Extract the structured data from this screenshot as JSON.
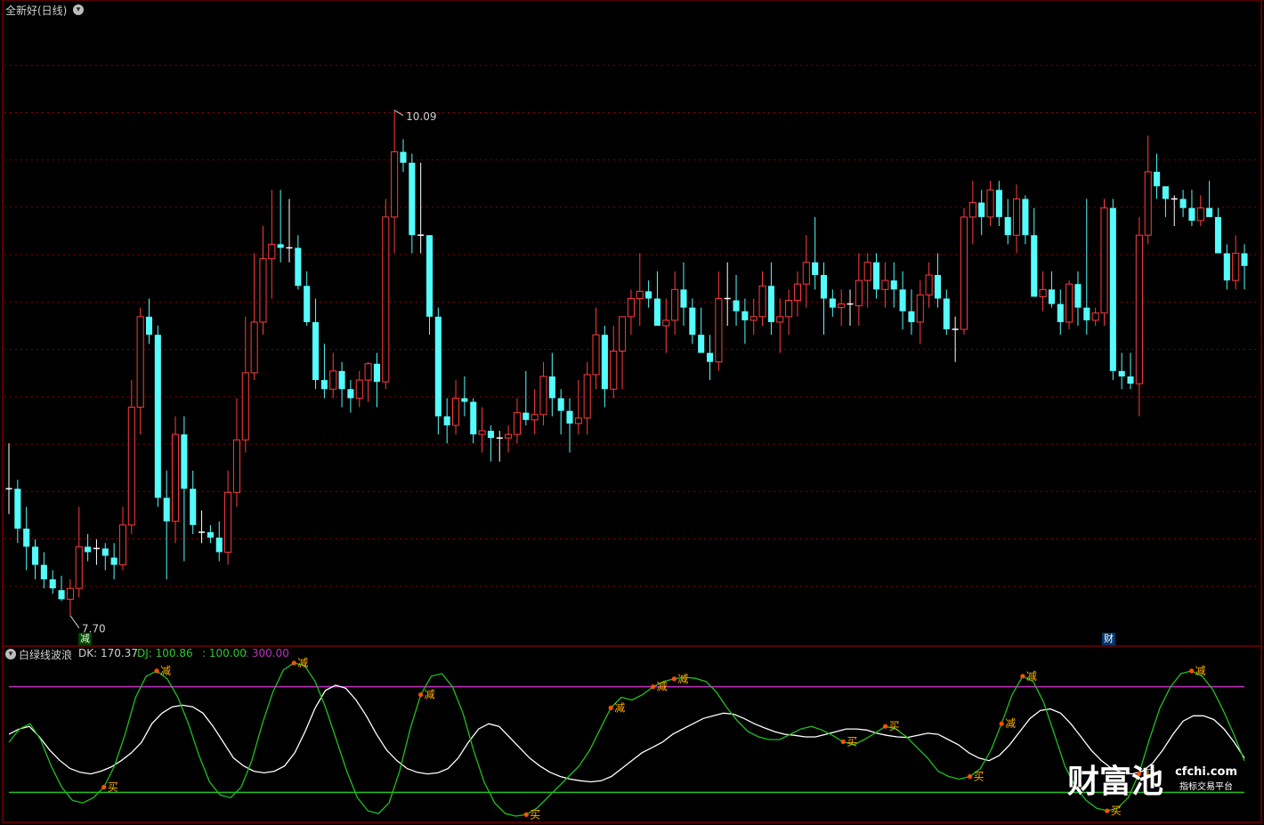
{
  "main_panel": {
    "title": "全新好(日线)",
    "high_label": "10.09",
    "low_label": "7.70",
    "badge_left": "减",
    "badge_right": "财",
    "colors": {
      "up": "#ff3c3c",
      "down": "#54fcfc",
      "grid": "#8b0000",
      "frame": "#aa0000"
    }
  },
  "indicator_panel": {
    "name": "白绿线波浪",
    "dk_label": "DK: 170.37",
    "dj_label": "DJ: 100.86",
    "line1_label": ": 100.00",
    "line2_label": ": 300.00",
    "colors": {
      "dk": "#ffffff",
      "dj": "#20c020",
      "line100": "#20c020",
      "line300": "#c030c0",
      "signal_text": "#ffb000",
      "signal_dot": "#ff5000"
    }
  },
  "watermark": {
    "brand": "财富池",
    "site": "cfchi.com",
    "tagline": "指标交易平台"
  },
  "chart_data": [
    {
      "type": "candlestick",
      "title": "全新好(日线)",
      "ylim": [
        7.2,
        10.6
      ],
      "annotations": [
        {
          "text": "10.09",
          "value": 10.09,
          "kind": "high"
        },
        {
          "text": "7.70",
          "value": 7.7,
          "kind": "low"
        }
      ],
      "ohlc": [
        [
          8.0,
          8.25,
          7.86,
          7.99
        ],
        [
          8.0,
          8.05,
          7.7,
          7.78
        ],
        [
          7.78,
          7.9,
          7.55,
          7.68
        ],
        [
          7.68,
          7.72,
          7.5,
          7.58
        ],
        [
          7.58,
          7.65,
          7.45,
          7.5
        ],
        [
          7.5,
          7.55,
          7.42,
          7.45
        ],
        [
          7.44,
          7.52,
          7.38,
          7.39
        ],
        [
          7.39,
          7.5,
          7.3,
          7.45
        ],
        [
          7.45,
          7.9,
          7.4,
          7.68
        ],
        [
          7.68,
          7.75,
          7.6,
          7.65
        ],
        [
          7.66,
          7.72,
          7.58,
          7.67
        ],
        [
          7.67,
          7.7,
          7.55,
          7.63
        ],
        [
          7.62,
          7.7,
          7.5,
          7.58
        ],
        [
          7.58,
          7.9,
          7.55,
          7.8
        ],
        [
          7.8,
          8.6,
          7.75,
          8.45
        ],
        [
          8.45,
          9.0,
          8.3,
          8.95
        ],
        [
          8.95,
          9.05,
          8.8,
          8.85
        ],
        [
          8.85,
          8.9,
          7.9,
          7.95
        ],
        [
          7.95,
          8.1,
          7.5,
          7.82
        ],
        [
          7.82,
          8.4,
          7.7,
          8.3
        ],
        [
          8.3,
          8.4,
          7.6,
          8.0
        ],
        [
          8.0,
          8.1,
          7.75,
          7.8
        ],
        [
          7.75,
          7.88,
          7.7,
          7.76
        ],
        [
          7.76,
          7.8,
          7.7,
          7.73
        ],
        [
          7.73,
          7.82,
          7.6,
          7.65
        ],
        [
          7.65,
          8.1,
          7.58,
          7.98
        ],
        [
          7.98,
          8.5,
          7.9,
          8.27
        ],
        [
          8.27,
          8.95,
          8.2,
          8.64
        ],
        [
          8.64,
          9.3,
          8.6,
          8.92
        ],
        [
          8.92,
          9.45,
          8.85,
          9.27
        ],
        [
          9.27,
          9.65,
          9.05,
          9.35
        ],
        [
          9.35,
          9.65,
          9.25,
          9.33
        ],
        [
          9.33,
          9.6,
          9.25,
          9.33
        ],
        [
          9.33,
          9.4,
          9.1,
          9.12
        ],
        [
          9.12,
          9.2,
          8.9,
          8.92
        ],
        [
          8.92,
          9.05,
          8.55,
          8.6
        ],
        [
          8.6,
          8.8,
          8.5,
          8.55
        ],
        [
          8.55,
          8.75,
          8.5,
          8.65
        ],
        [
          8.65,
          8.7,
          8.45,
          8.55
        ],
        [
          8.55,
          8.6,
          8.42,
          8.5
        ],
        [
          8.5,
          8.65,
          8.45,
          8.6
        ],
        [
          8.6,
          8.7,
          8.48,
          8.69
        ],
        [
          8.69,
          8.75,
          8.45,
          8.59
        ],
        [
          8.59,
          9.6,
          8.55,
          9.5
        ],
        [
          9.5,
          10.09,
          9.3,
          9.86
        ],
        [
          9.86,
          9.93,
          9.75,
          9.8
        ],
        [
          9.8,
          9.85,
          9.3,
          9.4
        ],
        [
          9.4,
          9.8,
          9.3,
          9.4
        ],
        [
          9.4,
          9.4,
          8.85,
          8.95
        ],
        [
          8.95,
          9.0,
          8.3,
          8.4
        ],
        [
          8.4,
          8.5,
          8.25,
          8.35
        ],
        [
          8.35,
          8.6,
          8.3,
          8.5
        ],
        [
          8.5,
          8.62,
          8.4,
          8.48
        ],
        [
          8.48,
          8.5,
          8.25,
          8.3
        ],
        [
          8.3,
          8.45,
          8.2,
          8.32
        ],
        [
          8.32,
          8.35,
          8.15,
          8.28
        ],
        [
          8.28,
          8.32,
          8.15,
          8.28
        ],
        [
          8.28,
          8.35,
          8.2,
          8.3
        ],
        [
          8.3,
          8.5,
          8.25,
          8.42
        ],
        [
          8.42,
          8.65,
          8.35,
          8.38
        ],
        [
          8.38,
          8.55,
          8.3,
          8.41
        ],
        [
          8.41,
          8.7,
          8.35,
          8.62
        ],
        [
          8.62,
          8.75,
          8.4,
          8.5
        ],
        [
          8.5,
          8.55,
          8.3,
          8.43
        ],
        [
          8.43,
          8.5,
          8.2,
          8.36
        ],
        [
          8.36,
          8.6,
          8.3,
          8.39
        ],
        [
          8.39,
          8.7,
          8.3,
          8.63
        ],
        [
          8.63,
          9.0,
          8.55,
          8.85
        ],
        [
          8.85,
          8.9,
          8.45,
          8.55
        ],
        [
          8.55,
          8.9,
          8.5,
          8.76
        ],
        [
          8.76,
          8.95,
          8.55,
          8.95
        ],
        [
          8.95,
          9.1,
          8.85,
          9.05
        ],
        [
          9.05,
          9.3,
          8.9,
          9.09
        ],
        [
          9.09,
          9.15,
          9.0,
          9.05
        ],
        [
          9.05,
          9.2,
          8.9,
          8.9
        ],
        [
          8.9,
          9.05,
          8.75,
          8.93
        ],
        [
          8.93,
          9.2,
          8.85,
          9.1
        ],
        [
          9.1,
          9.25,
          8.9,
          9.0
        ],
        [
          9.0,
          9.05,
          8.8,
          8.85
        ],
        [
          8.85,
          9.0,
          8.75,
          8.75
        ],
        [
          8.75,
          8.85,
          8.6,
          8.7
        ],
        [
          8.7,
          9.2,
          8.65,
          9.05
        ],
        [
          9.05,
          9.25,
          8.9,
          9.04
        ],
        [
          9.04,
          9.18,
          8.9,
          8.98
        ],
        [
          8.98,
          9.05,
          8.8,
          8.93
        ],
        [
          8.93,
          9.05,
          8.85,
          8.95
        ],
        [
          8.95,
          9.2,
          8.9,
          9.12
        ],
        [
          9.12,
          9.25,
          8.85,
          8.92
        ],
        [
          8.92,
          9.05,
          8.75,
          8.95
        ],
        [
          8.95,
          9.1,
          8.85,
          9.04
        ],
        [
          9.04,
          9.2,
          8.95,
          9.13
        ],
        [
          9.13,
          9.4,
          9.0,
          9.25
        ],
        [
          9.25,
          9.5,
          9.1,
          9.18
        ],
        [
          9.18,
          9.25,
          8.85,
          9.05
        ],
        [
          9.05,
          9.1,
          8.95,
          9.0
        ],
        [
          9.0,
          9.1,
          8.9,
          9.02
        ],
        [
          9.02,
          9.1,
          8.9,
          9.01
        ],
        [
          9.01,
          9.3,
          8.9,
          9.15
        ],
        [
          9.15,
          9.3,
          9.0,
          9.25
        ],
        [
          9.25,
          9.3,
          9.05,
          9.1
        ],
        [
          9.1,
          9.25,
          9.0,
          9.15
        ],
        [
          9.15,
          9.25,
          9.0,
          9.1
        ],
        [
          9.1,
          9.2,
          8.88,
          8.98
        ],
        [
          8.98,
          9.1,
          8.85,
          8.92
        ],
        [
          8.92,
          9.15,
          8.8,
          9.07
        ],
        [
          9.07,
          9.25,
          9.0,
          9.18
        ],
        [
          9.18,
          9.3,
          9.0,
          9.05
        ],
        [
          9.05,
          9.1,
          8.85,
          8.88
        ],
        [
          8.88,
          8.95,
          8.7,
          8.88
        ],
        [
          8.88,
          9.55,
          8.85,
          9.5
        ],
        [
          9.5,
          9.7,
          9.35,
          9.58
        ],
        [
          9.58,
          9.65,
          9.4,
          9.5
        ],
        [
          9.5,
          9.7,
          9.45,
          9.65
        ],
        [
          9.65,
          9.7,
          9.45,
          9.5
        ],
        [
          9.5,
          9.6,
          9.35,
          9.4
        ],
        [
          9.4,
          9.68,
          9.3,
          9.6
        ],
        [
          9.6,
          9.62,
          9.35,
          9.4
        ],
        [
          9.4,
          9.55,
          9.3,
          9.06
        ],
        [
          9.06,
          9.2,
          8.98,
          9.1
        ],
        [
          9.1,
          9.2,
          9.0,
          9.02
        ],
        [
          9.02,
          9.1,
          8.85,
          8.92
        ],
        [
          8.92,
          9.15,
          8.88,
          9.13
        ],
        [
          9.13,
          9.2,
          8.9,
          9.0
        ],
        [
          9.0,
          9.6,
          8.85,
          8.93
        ],
        [
          8.93,
          9.0,
          8.9,
          8.97
        ],
        [
          8.97,
          9.6,
          8.9,
          9.55
        ],
        [
          9.55,
          9.6,
          8.6,
          8.65
        ],
        [
          8.65,
          8.75,
          8.55,
          8.62
        ],
        [
          8.62,
          8.75,
          8.55,
          8.58
        ],
        [
          8.58,
          9.5,
          8.4,
          9.4
        ],
        [
          9.4,
          9.95,
          9.35,
          9.75
        ],
        [
          9.75,
          9.85,
          9.6,
          9.67
        ],
        [
          9.67,
          9.65,
          9.5,
          9.6
        ],
        [
          9.6,
          9.62,
          9.45,
          9.6
        ],
        [
          9.6,
          9.65,
          9.5,
          9.55
        ],
        [
          9.55,
          9.65,
          9.45,
          9.48
        ],
        [
          9.48,
          9.62,
          9.45,
          9.55
        ],
        [
          9.55,
          9.7,
          9.5,
          9.5
        ],
        [
          9.5,
          9.55,
          9.3,
          9.3
        ],
        [
          9.3,
          9.35,
          9.1,
          9.15
        ],
        [
          9.15,
          9.4,
          9.1,
          9.3
        ],
        [
          9.3,
          9.35,
          9.1,
          9.23
        ]
      ]
    },
    {
      "type": "line",
      "title": "白绿线波浪",
      "ylim": [
        50,
        350
      ],
      "series": [
        {
          "name": "DK",
          "values": [
            210,
            220,
            225,
            205,
            180,
            160,
            145,
            138,
            135,
            140,
            148,
            160,
            175,
            195,
            230,
            250,
            262,
            265,
            262,
            250,
            225,
            195,
            165,
            150,
            140,
            137,
            140,
            150,
            175,
            215,
            260,
            293,
            303,
            297,
            275,
            245,
            210,
            180,
            160,
            145,
            138,
            135,
            137,
            145,
            165,
            195,
            220,
            230,
            225,
            205,
            185,
            165,
            150,
            138,
            130,
            125,
            122,
            120,
            122,
            130,
            145,
            160,
            175,
            185,
            195,
            210,
            220,
            230,
            240,
            245,
            250,
            248,
            240,
            230,
            222,
            215,
            210,
            208,
            205,
            205,
            210,
            215,
            220,
            220,
            218,
            212,
            208,
            205,
            204,
            208,
            212,
            210,
            200,
            190,
            175,
            165,
            160,
            170,
            190,
            215,
            240,
            255,
            258,
            250,
            230,
            205,
            180,
            160,
            145,
            138,
            135,
            140,
            155,
            180,
            210,
            235,
            245,
            245,
            238,
            220,
            195,
            165
          ]
        },
        {
          "name": "DJ",
          "values": [
            195,
            220,
            230,
            200,
            150,
            110,
            85,
            80,
            90,
            110,
            150,
            210,
            280,
            320,
            330,
            315,
            280,
            230,
            170,
            120,
            95,
            90,
            110,
            160,
            230,
            290,
            332,
            345,
            340,
            310,
            260,
            200,
            140,
            90,
            65,
            60,
            80,
            140,
            220,
            285,
            320,
            325,
            300,
            250,
            180,
            120,
            80,
            60,
            55,
            58,
            70,
            90,
            110,
            130,
            150,
            180,
            220,
            260,
            280,
            275,
            285,
            300,
            310,
            315,
            318,
            316,
            310,
            290,
            260,
            235,
            215,
            205,
            200,
            200,
            210,
            220,
            225,
            218,
            208,
            196,
            190,
            200,
            212,
            225,
            220,
            205,
            185,
            165,
            140,
            130,
            125,
            130,
            145,
            180,
            230,
            285,
            320,
            310,
            270,
            210,
            150,
            110,
            85,
            70,
            65,
            70,
            90,
            135,
            200,
            260,
            300,
            325,
            330,
            320,
            295,
            255,
            210,
            160
          ]
        },
        {
          "name": "100.00",
          "values": [
            100
          ]
        },
        {
          "name": "300.00",
          "values": [
            300
          ]
        }
      ],
      "signals": [
        {
          "text": "买",
          "index": 9
        },
        {
          "text": "减",
          "index": 14
        },
        {
          "text": "减",
          "index": 27
        },
        {
          "text": "减",
          "index": 39
        },
        {
          "text": "买",
          "index": 49
        },
        {
          "text": "减",
          "index": 57
        },
        {
          "text": "减",
          "index": 61
        },
        {
          "text": "减",
          "index": 63
        },
        {
          "text": "买",
          "index": 79
        },
        {
          "text": "买",
          "index": 83
        },
        {
          "text": "买",
          "index": 91
        },
        {
          "text": "减",
          "index": 94
        },
        {
          "text": "减",
          "index": 96
        },
        {
          "text": "买",
          "index": 104
        },
        {
          "text": "买",
          "index": 107
        },
        {
          "text": "减",
          "index": 112
        }
      ]
    }
  ]
}
